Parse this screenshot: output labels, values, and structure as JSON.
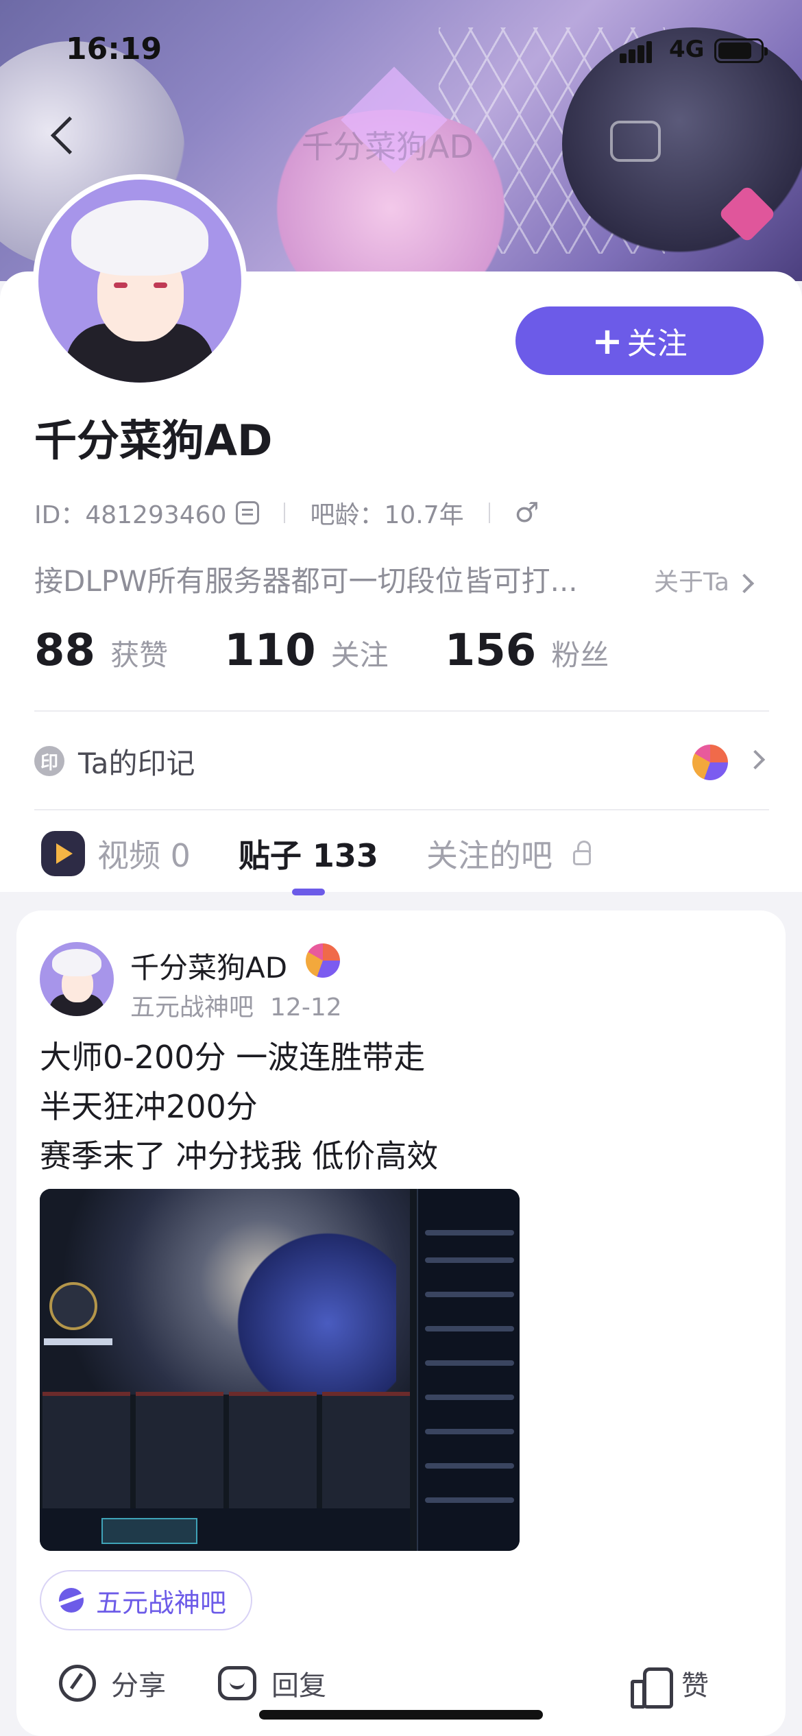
{
  "status_bar": {
    "time": "16:19",
    "network": "4G",
    "battery_level": 0.8
  },
  "nav": {
    "title": "千分菜狗AD"
  },
  "profile": {
    "username": "千分菜狗AD",
    "follow_label": "关注",
    "id_text": "ID：481293460",
    "age_text": "吧龄：10.7年",
    "gender_symbol": "♂",
    "bio": "接DLPW所有服务器都可一切段位皆可打...",
    "about_label": "关于Ta",
    "stats": [
      {
        "num": "88",
        "label": "获赞"
      },
      {
        "num": "110",
        "label": "关注"
      },
      {
        "num": "156",
        "label": "粉丝"
      }
    ],
    "mark_badge": "印",
    "mark_label": "Ta的印记"
  },
  "tabs": [
    {
      "label": "视频 0"
    },
    {
      "label": "贴子 133"
    },
    {
      "label": "关注的吧"
    }
  ],
  "post": {
    "author": "千分菜狗AD",
    "forum": "五元战神吧",
    "date": "12-12",
    "lines": [
      "大师0-200分  一波连胜带走",
      "半天狂冲200分",
      "赛季末了 冲分找我 低价高效"
    ],
    "tag": "五元战神吧",
    "actions": {
      "share": "分享",
      "reply": "回复",
      "like": "赞"
    }
  },
  "colors": {
    "accent": "#6c5be8"
  }
}
